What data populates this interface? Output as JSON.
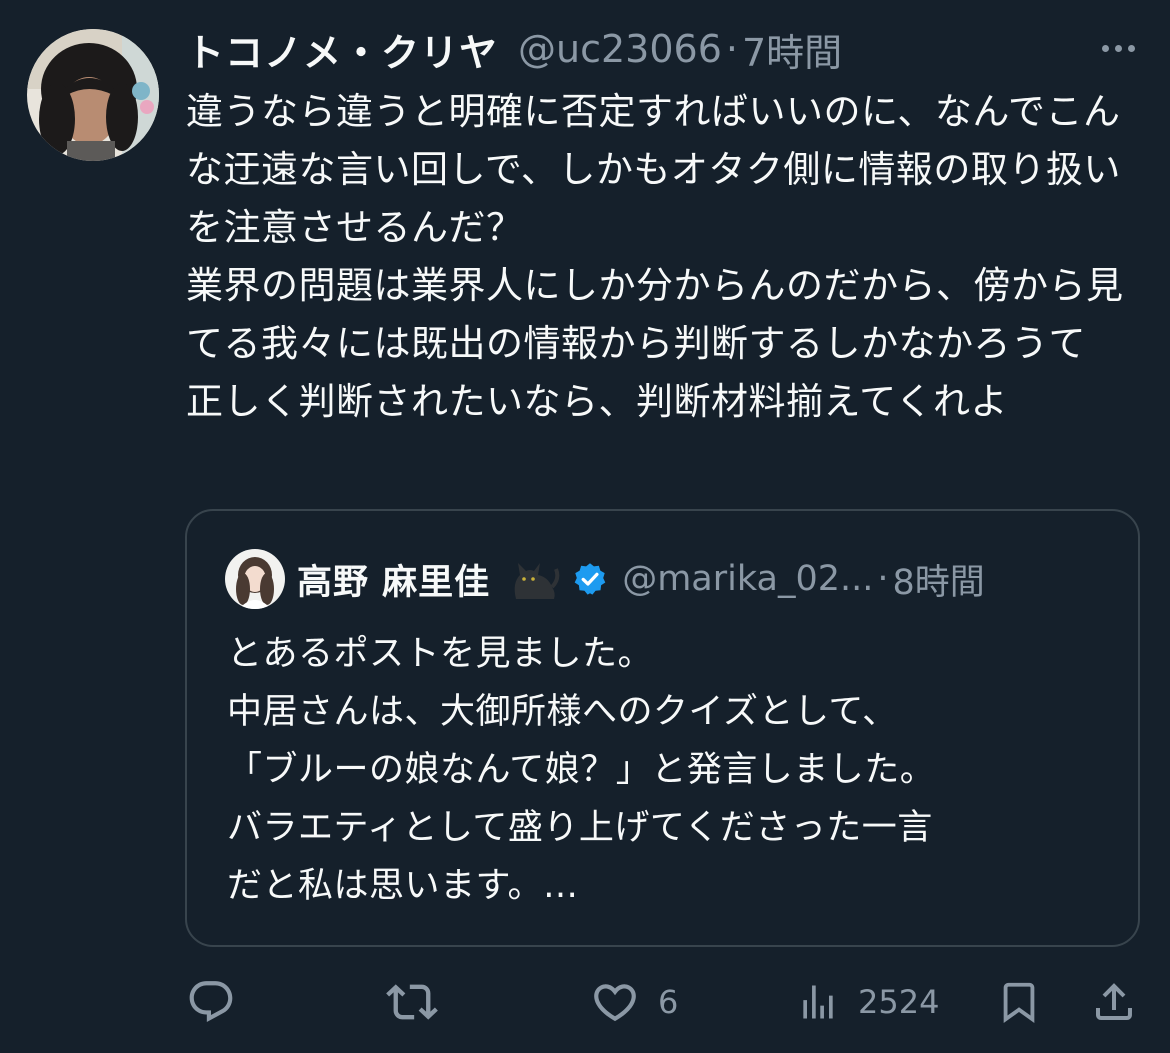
{
  "tweet": {
    "author_name": "トコノメ・クリヤ",
    "author_handle": "@uc23066",
    "separator": "·",
    "time": "7時間",
    "body": "違うなら違うと明確に否定すればいいのに、なんでこんな迂遠な言い回しで、しかもオタク側に情報の取り扱いを注意させるんだ？\n業界の問題は業界人にしか分からんのだから、傍から見てる我々には既出の情報から判断するしかなかろうて\n正しく判断されたいなら、判断材料揃えてくれよ"
  },
  "quoted": {
    "author_name": "高野 麻里佳",
    "author_handle": "@marika_02...",
    "separator": "·",
    "time": "8時間",
    "body": "とあるポストを見ました。\n中居さんは、大御所様へのクイズとして、\n「ブルーの娘なんて娘？」と発言しました。\nバラエティとして盛り上げてくださった一言\nだと私は思います。…"
  },
  "actions": {
    "reply_count": "",
    "retweet_count": "",
    "like_count": "6",
    "views_count": "2524"
  },
  "colors": {
    "background": "#15202b",
    "text_primary": "#f7f9f9",
    "text_secondary": "#8b98a5",
    "border": "#38444d",
    "verified": "#1d9bf0"
  },
  "icons": {
    "more": "more-horizontal-icon",
    "verified": "verified-badge-icon",
    "cat": "black-cat-emoji",
    "reply": "reply-icon",
    "retweet": "retweet-icon",
    "like": "heart-icon",
    "views": "views-chart-icon",
    "bookmark": "bookmark-icon",
    "share": "share-icon"
  }
}
